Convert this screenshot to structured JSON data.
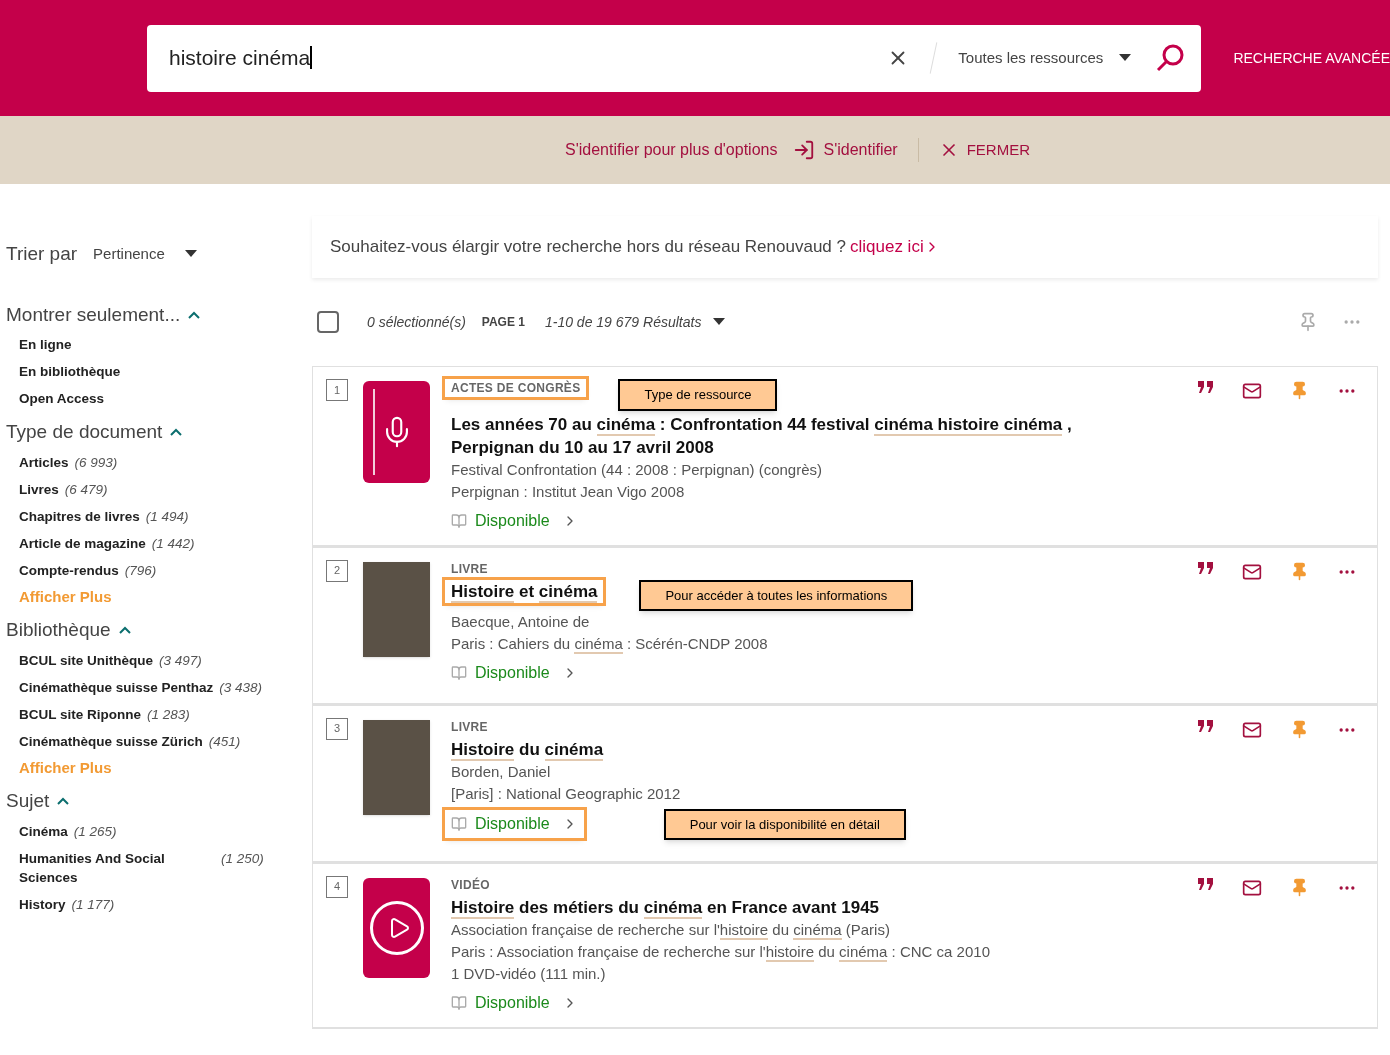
{
  "search": {
    "value": "histoire cinéma",
    "scope": "Toutes les ressources",
    "advanced": "RECHERCHE AVANCÉE"
  },
  "login_bar": {
    "prompt": "S'identifier pour plus d'options",
    "login": "S'identifier",
    "close": "FERMER"
  },
  "sort": {
    "label": "Trier par",
    "value": "Pertinence"
  },
  "facets": [
    {
      "title": "Montrer seulement...",
      "expanded": true,
      "items": [
        {
          "label": "En ligne"
        },
        {
          "label": "En bibliothèque"
        },
        {
          "label": "Open Access"
        }
      ]
    },
    {
      "title": "Type de document",
      "expanded": true,
      "items": [
        {
          "label": "Articles",
          "count": "(6 993)"
        },
        {
          "label": "Livres",
          "count": "(6 479)"
        },
        {
          "label": "Chapitres de livres",
          "count": "(1 494)"
        },
        {
          "label": "Article de magazine",
          "count": "(1 442)"
        },
        {
          "label": "Compte-rendus",
          "count": "(796)"
        }
      ],
      "more": "Afficher Plus"
    },
    {
      "title": "Bibliothèque",
      "expanded": true,
      "items": [
        {
          "label": "BCUL site Unithèque",
          "count": "(3 497)"
        },
        {
          "label": "Cinémathèque suisse Penthaz",
          "count": "(3 438)"
        },
        {
          "label": "BCUL site Riponne",
          "count": "(1 283)"
        },
        {
          "label": "Cinémathèque suisse Zürich",
          "count": "(451)"
        }
      ],
      "more": "Afficher Plus"
    },
    {
      "title": "Sujet",
      "expanded": true,
      "items": [
        {
          "label": "Cinéma",
          "count": "(1 265)"
        },
        {
          "label": "Humanities And Social Sciences",
          "count": "(1 250)"
        },
        {
          "label": "History",
          "count": "(1 177)"
        }
      ]
    }
  ],
  "banner": {
    "text": "Souhaitez-vous élargir votre recherche hors du réseau Renouvaud ?",
    "link": "cliquez ici"
  },
  "results_bar": {
    "selected_all": false,
    "selected": "0 sélectionné(s)",
    "page": "PAGE 1",
    "range": "1-10 de 19 679 Résultats"
  },
  "results": [
    {
      "number": "1",
      "selected": false,
      "kind": "conference",
      "type": "ACTES DE CONGRÈS",
      "type_highlighted": true,
      "title_highlighted": false,
      "title": [
        {
          "t": "Les années 70 au "
        },
        {
          "t": "cinéma",
          "hl": true
        },
        {
          "t": " : Confrontation 44 festival "
        },
        {
          "t": "cinéma histoire cinéma",
          "hl": true
        },
        {
          "t": " , Perpignan du 10 au 17 avril 2008"
        }
      ],
      "lines": [
        [
          {
            "t": "Festival Confrontation (44 : 2008 : Perpignan) (congrès)"
          }
        ],
        [
          {
            "t": "Perpignan : Institut Jean Vigo 2008"
          }
        ]
      ],
      "availability": "Disponible",
      "availability_highlighted": false,
      "callout": "Type de ressource"
    },
    {
      "number": "2",
      "selected": false,
      "kind": "cover",
      "type": "LIVRE",
      "type_highlighted": false,
      "title_highlighted": true,
      "title": [
        {
          "t": "Histoire",
          "hl": true
        },
        {
          "t": " et "
        },
        {
          "t": "cinéma",
          "hl": true
        }
      ],
      "lines": [
        [
          {
            "t": "Baecque, Antoine de"
          }
        ],
        [
          {
            "t": "Paris : Cahiers du "
          },
          {
            "t": "cinéma",
            "hl": true
          },
          {
            "t": " : Scérén-CNDP 2008"
          }
        ]
      ],
      "availability": "Disponible",
      "availability_highlighted": false,
      "callout": "Pour accéder à toutes les informations"
    },
    {
      "number": "3",
      "selected": false,
      "kind": "cover",
      "type": "LIVRE",
      "type_highlighted": false,
      "title_highlighted": false,
      "title": [
        {
          "t": "Histoire",
          "hl": true
        },
        {
          "t": " du "
        },
        {
          "t": "cinéma",
          "hl": true
        }
      ],
      "lines": [
        [
          {
            "t": "Borden, Daniel"
          }
        ],
        [
          {
            "t": "[Paris] : National Geographic 2012"
          }
        ]
      ],
      "availability": "Disponible",
      "availability_highlighted": true,
      "callout": "Pour voir la disponibilité en détail"
    },
    {
      "number": "4",
      "selected": false,
      "kind": "video",
      "type": "VIDÉO",
      "type_highlighted": false,
      "title_highlighted": false,
      "title": [
        {
          "t": "Histoire",
          "hl": true
        },
        {
          "t": " des métiers du "
        },
        {
          "t": "cinéma",
          "hl": true
        },
        {
          "t": " en France avant 1945"
        }
      ],
      "lines": [
        [
          {
            "t": "Association française de recherche sur l'"
          },
          {
            "t": "histoire",
            "hl": true
          },
          {
            "t": " du "
          },
          {
            "t": "cinéma",
            "hl": true
          },
          {
            "t": " (Paris)"
          }
        ],
        [
          {
            "t": "Paris : Association française de recherche sur l'"
          },
          {
            "t": "histoire",
            "hl": true
          },
          {
            "t": " du "
          },
          {
            "t": "cinéma",
            "hl": true
          },
          {
            "t": " : CNC ca 2010"
          }
        ],
        [
          {
            "t": "1 DVD-vidéo (111 min.)"
          }
        ]
      ],
      "availability": "Disponible",
      "availability_highlighted": false
    }
  ]
}
